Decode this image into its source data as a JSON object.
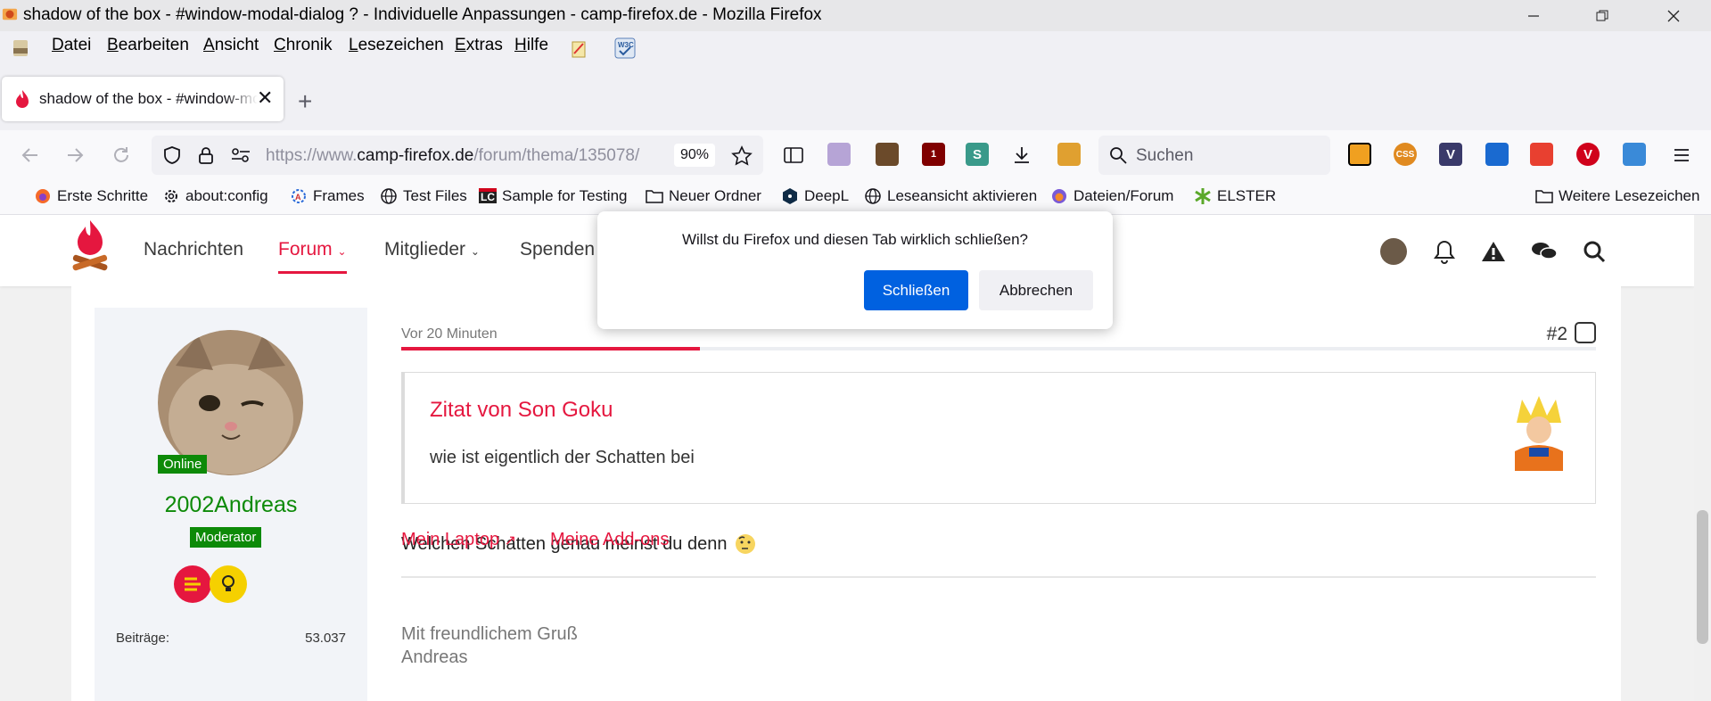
{
  "window": {
    "title": "shadow of the box - #window-modal-dialog ? - Individuelle Anpassungen - camp-firefox.de - Mozilla Firefox",
    "minimize": "—",
    "maximize": "❐",
    "close": "✕"
  },
  "menu": [
    "Datei",
    "Bearbeiten",
    "Ansicht",
    "Chronik",
    "Lesezeichen",
    "Extras",
    "Hilfe"
  ],
  "tab": {
    "title": "shadow of the box - #window-modal-dialog ?",
    "close": "✕",
    "new_tab": "+"
  },
  "navbar": {
    "url_prefix": "https://www.",
    "url_domain": "camp-firefox.de",
    "url_path": "/forum/thema/135078/",
    "zoom": "90%",
    "search_placeholder": "Suchen",
    "ext_badge_ublock": "1"
  },
  "bookmarks": [
    {
      "label": "Erste Schritte",
      "icon": "firefox-icon"
    },
    {
      "label": "about:config",
      "icon": "gear-icon"
    },
    {
      "label": "Frames",
      "icon": "frames-icon"
    },
    {
      "label": "Test Files",
      "icon": "globe-icon"
    },
    {
      "label": "Sample for Testing",
      "icon": "lc-icon"
    },
    {
      "label": "Neuer Ordner",
      "icon": "folder-icon"
    },
    {
      "label": "DeepL",
      "icon": "deepl-icon"
    },
    {
      "label": "Leseansicht aktivieren",
      "icon": "globe-icon"
    },
    {
      "label": "Dateien/Forum",
      "icon": "forum-icon"
    },
    {
      "label": "ELSTER",
      "icon": "elster-icon"
    }
  ],
  "bookmarks_more": "Weitere Lesezeichen",
  "site": {
    "nav": [
      "Nachrichten",
      "Forum",
      "Mitglieder",
      "Spenden"
    ],
    "active_nav": "Forum",
    "colors": {
      "accent": "#e5173f",
      "online": "#0d8a08",
      "primary_button": "#0061e0"
    }
  },
  "user": {
    "status": "Online",
    "name": "2002Andreas",
    "role": "Moderator",
    "posts_label": "Beiträge",
    "posts_value": "53.037"
  },
  "post": {
    "time": "Vor 20 Minuten",
    "number": "#2",
    "quote_title": "Zitat von Son Goku",
    "quote_text": "wie ist eigentlich der Schatten bei",
    "answer": "Welchen Schatten genau meinst du denn",
    "signature": [
      "Mit freundlichem Gruß",
      "Andreas"
    ],
    "links": [
      "Mein Laptop",
      "Meine Add-ons"
    ],
    "read_progress": 0.25
  },
  "dialog": {
    "message": "Willst du Firefox und diesen Tab wirklich schließen?",
    "confirm": "Schließen",
    "cancel": "Abbrechen"
  }
}
